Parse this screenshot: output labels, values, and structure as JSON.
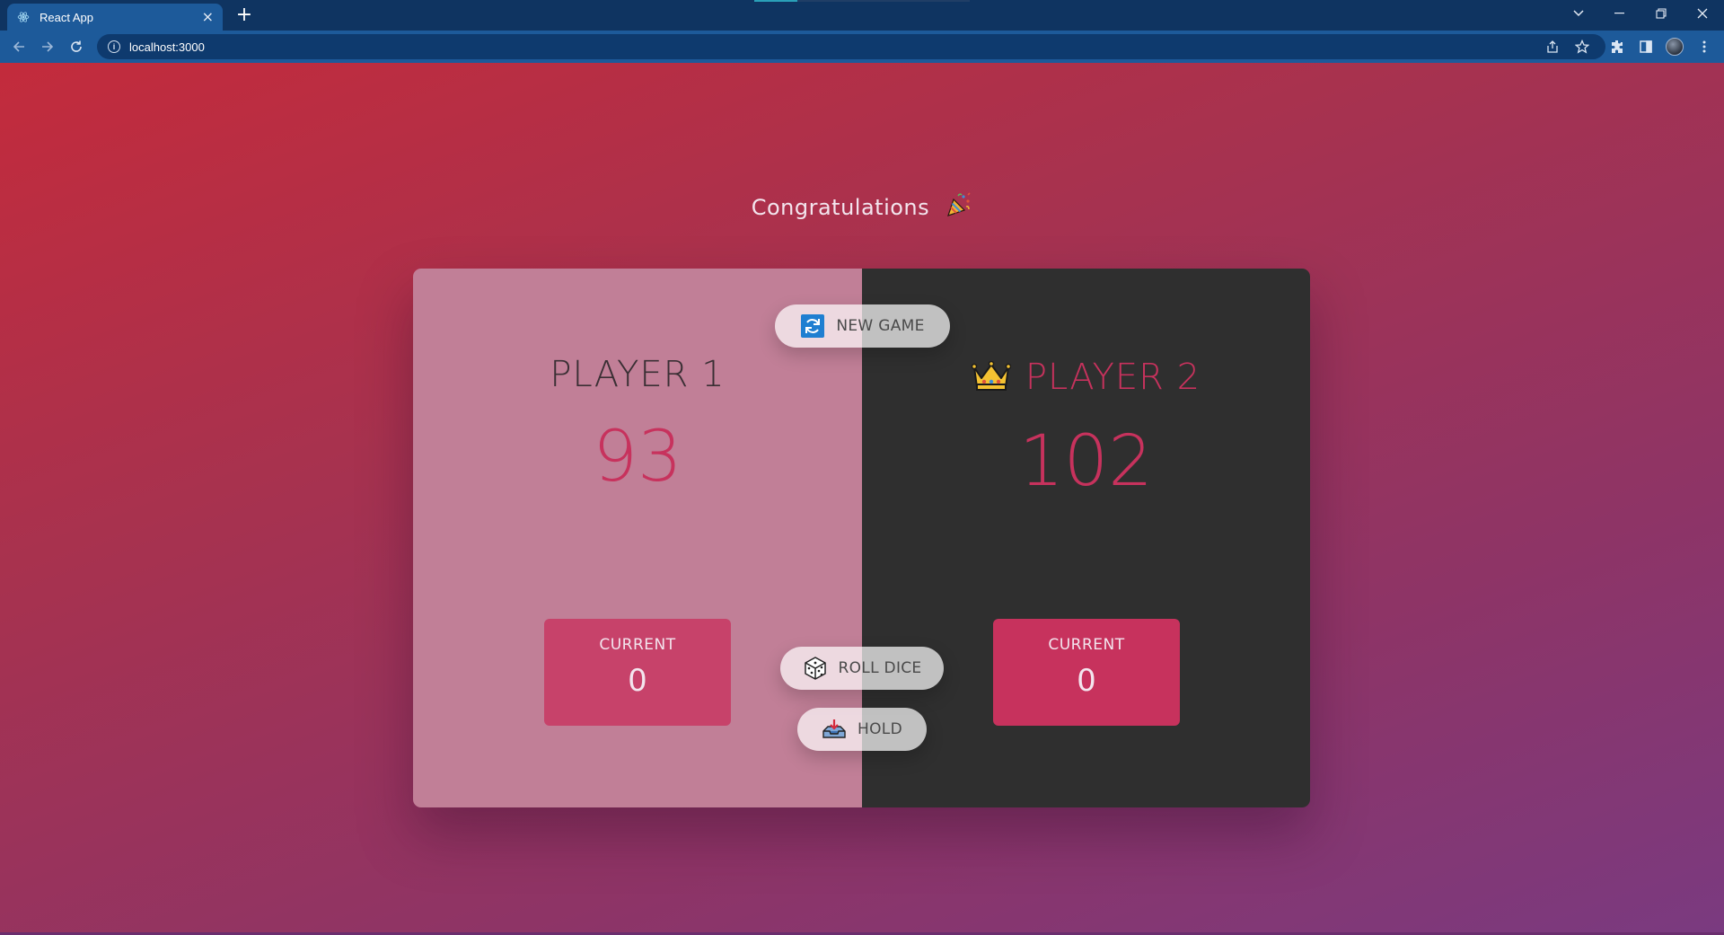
{
  "browser": {
    "tab_title": "React App",
    "url": "localhost:3000",
    "tab_close_glyph": "×",
    "new_tab_glyph": "+"
  },
  "page": {
    "congrats_text": "Congratulations",
    "congrats_emoji": "party-popper-icon",
    "new_game_label": "NEW GAME",
    "roll_dice_label": "ROLL DICE",
    "hold_label": "HOLD",
    "players": [
      {
        "name": "PLAYER 1",
        "score": "93",
        "current_label": "CURRENT",
        "current_value": "0",
        "winner": false
      },
      {
        "name": "PLAYER 2",
        "score": "102",
        "current_label": "CURRENT",
        "current_value": "0",
        "winner": true
      }
    ]
  },
  "colors": {
    "accent": "#c7325d",
    "active_panel": "#2f2f2f",
    "inactive_panel": "#c17f97"
  }
}
